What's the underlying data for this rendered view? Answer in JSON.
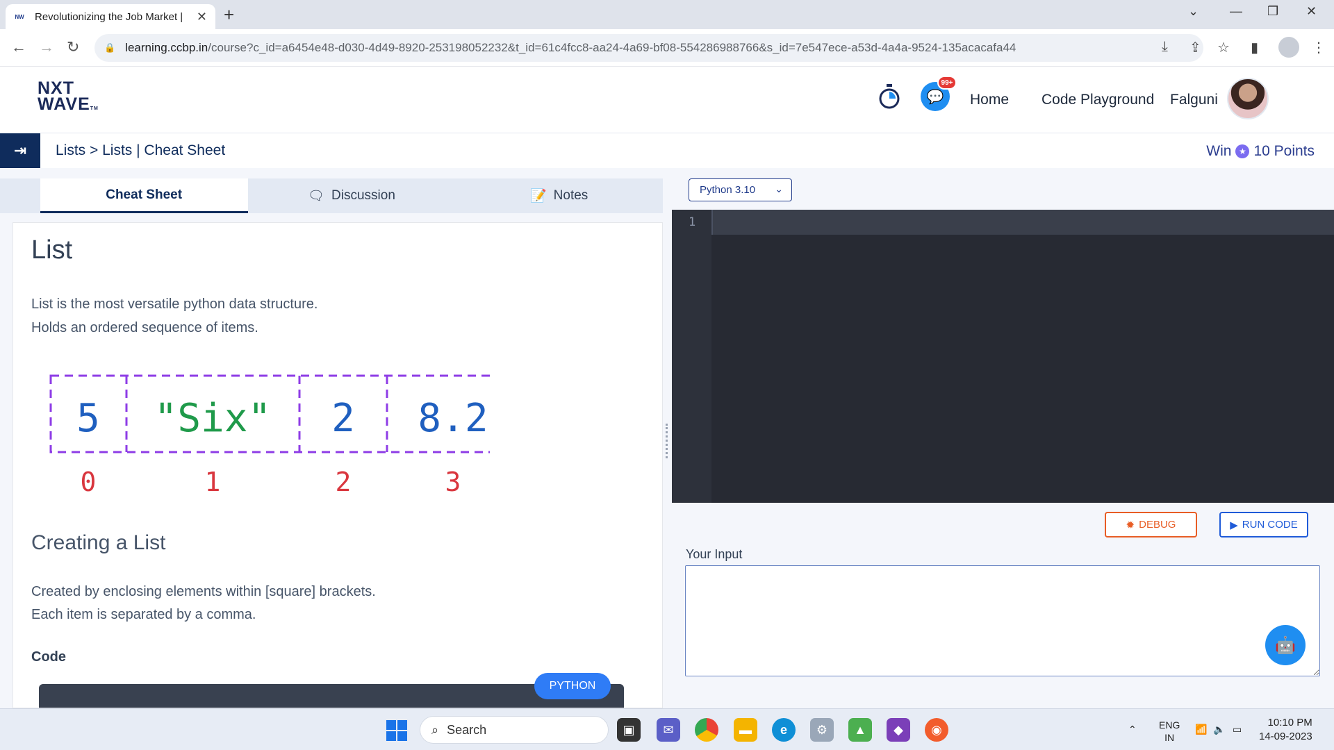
{
  "browser": {
    "tab_title": "Revolutionizing the Job Market |",
    "tab_favicon": "NW",
    "url_host": "learning.ccbp.in",
    "url_path": "/course?c_id=a6454e48-d030-4d49-8920-253198052232&t_id=61c4fcc8-aa24-4a69-bf08-554286988766&s_id=7e547ece-a53d-4a4a-9524-135acacafa44"
  },
  "header": {
    "logo_line1": "NXT",
    "logo_line2": "WAVE",
    "logo_tm": "TM",
    "badge": "99+",
    "nav": [
      "Home",
      "Code Playground"
    ],
    "user_name": "Falguni"
  },
  "breadcrumb": {
    "text": "Lists > Lists | Cheat Sheet",
    "points_prefix": "Win",
    "points_value": "10 Points"
  },
  "tabs": [
    {
      "label": "Cheat Sheet",
      "icon": "none"
    },
    {
      "label": "Discussion",
      "icon": "comment-icon"
    },
    {
      "label": "Notes",
      "icon": "notes-icon"
    }
  ],
  "content": {
    "title": "List",
    "intro_1": "List is the most versatile python data structure.",
    "intro_2": "Holds an ordered sequence of items.",
    "diagram_values": [
      "5",
      "\"Six\"",
      "2",
      "8.2"
    ],
    "diagram_indices": [
      "0",
      "1",
      "2",
      "3"
    ],
    "section_title": "Creating a List",
    "section_p1": "Created by enclosing elements within [square] brackets.",
    "section_p2": "Each item is separated by a comma.",
    "code_label": "Code",
    "code_lang_badge": "PYTHON"
  },
  "editor": {
    "language": "Python 3.10",
    "line_number": "1",
    "debug_label": "DEBUG",
    "run_label": "RUN CODE",
    "input_label": "Your Input"
  },
  "taskbar": {
    "search_placeholder": "Search",
    "lang_1": "ENG",
    "lang_2": "IN",
    "time": "10:10 PM",
    "date": "14-09-2023"
  },
  "colors": {
    "primary": "#0f2c5c",
    "diagram_border": "#8e3ce6",
    "diagram_value_blue": "#1f5fbf",
    "diagram_value_green": "#1f9a4a",
    "diagram_index_red": "#d9363e",
    "debug": "#e85d25",
    "run": "#1f5bd8"
  }
}
